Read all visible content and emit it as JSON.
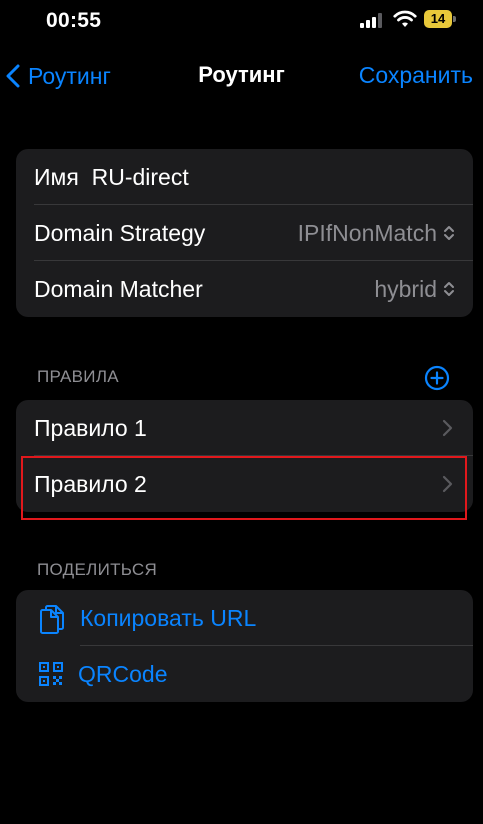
{
  "status_bar": {
    "time": "00:55",
    "battery": "14"
  },
  "nav": {
    "back_label": "Роутинг",
    "title": "Роутинг",
    "save_label": "Сохранить"
  },
  "settings": {
    "name_label": "Имя",
    "name_value": "RU-direct",
    "domain_strategy_label": "Domain Strategy",
    "domain_strategy_value": "IPIfNonMatch",
    "domain_matcher_label": "Domain Matcher",
    "domain_matcher_value": "hybrid"
  },
  "rules": {
    "header": "ПРАВИЛА",
    "items": [
      {
        "label": "Правило 1"
      },
      {
        "label": "Правило 2"
      }
    ]
  },
  "share": {
    "header": "ПОДЕЛИТЬСЯ",
    "copy_url_label": "Копировать URL",
    "qrcode_label": "QRCode"
  },
  "colors": {
    "accent": "#0a84ff",
    "cell": "#1c1c1e",
    "secondary": "#8e8e93",
    "highlight": "#e1181c"
  },
  "icons": [
    "chevron-left-icon",
    "add-circle-icon",
    "chevron-right-icon",
    "updown-chevron-icon",
    "copy-document-icon",
    "qrcode-icon",
    "wifi-icon",
    "signal-icon",
    "battery-icon"
  ]
}
